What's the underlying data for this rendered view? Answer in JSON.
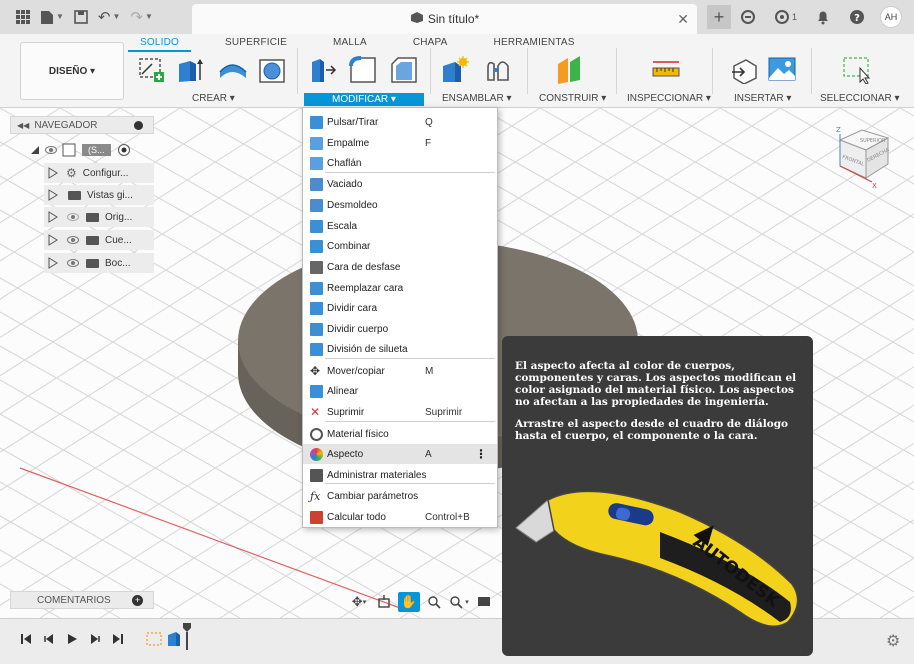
{
  "titlebar": {
    "document_title": "Sin título*",
    "jobs_count": "1",
    "user_initials": "AH"
  },
  "ribbon": {
    "tabs": [
      {
        "label": "SOLIDO",
        "active": true
      },
      {
        "label": "SUPERFICIE",
        "active": false
      },
      {
        "label": "MALLA",
        "active": false
      },
      {
        "label": "CHAPA",
        "active": false
      },
      {
        "label": "HERRAMIENTAS",
        "active": false
      }
    ],
    "workspace": "DISEÑO ▾",
    "groups": {
      "crear": "CREAR ▾",
      "modificar": "MODIFICAR ▾",
      "ensamblar": "ENSAMBLAR ▾",
      "construir": "CONSTRUIR ▾",
      "inspeccionar": "INSPECCIONAR ▾",
      "insertar": "INSERTAR ▾",
      "seleccionar": "SELECCIONAR ▾"
    }
  },
  "navigator": {
    "title": "NAVEGADOR",
    "root_label": "(S...",
    "items": [
      {
        "label": "Configur..."
      },
      {
        "label": "Vistas gi..."
      },
      {
        "label": "Orig..."
      },
      {
        "label": "Cue..."
      },
      {
        "label": "Boc..."
      }
    ]
  },
  "comments": {
    "label": "COMENTARIOS"
  },
  "viewcube": {
    "front": "FRONTAL",
    "right": "DERECHA",
    "top": "SUPERIOR",
    "axis_x": "X",
    "axis_z": "Z"
  },
  "menu": {
    "items": [
      {
        "label": "Pulsar/Tirar",
        "shortcut": "Q",
        "icon_color": "#3a8fd6"
      },
      {
        "label": "Empalme",
        "shortcut": "F",
        "icon_color": "#5aa0e0"
      },
      {
        "label": "Chaflán",
        "shortcut": "",
        "icon_color": "#5aa0e0"
      },
      {
        "label": "Vaciado",
        "shortcut": "",
        "icon_color": "#4b8ccf"
      },
      {
        "label": "Desmoldeo",
        "shortcut": "",
        "icon_color": "#4b8ccf"
      },
      {
        "label": "Escala",
        "shortcut": "",
        "icon_color": "#3a8fd6"
      },
      {
        "label": "Combinar",
        "shortcut": "",
        "icon_color": "#3a8fd6"
      },
      {
        "label": "Cara de desfase",
        "shortcut": "",
        "icon_color": "#666666"
      },
      {
        "label": "Reemplazar cara",
        "shortcut": "",
        "icon_color": "#3a8fd6"
      },
      {
        "label": "Dividir cara",
        "shortcut": "",
        "icon_color": "#3a8fd6"
      },
      {
        "label": "Dividir cuerpo",
        "shortcut": "",
        "icon_color": "#3a8fd6"
      },
      {
        "label": "División de silueta",
        "shortcut": "",
        "icon_color": "#3a8fd6"
      },
      {
        "label": "Mover/copiar",
        "shortcut": "M",
        "icon_color": "#333333"
      },
      {
        "label": "Alinear",
        "shortcut": "",
        "icon_color": "#3a8fd6"
      },
      {
        "label": "Suprimir",
        "shortcut": "Suprimir",
        "icon_color": "#e03030"
      },
      {
        "label": "Material físico",
        "shortcut": "",
        "icon_color": "#555555"
      },
      {
        "label": "Aspecto",
        "shortcut": "A",
        "icon_color": "#e8a030"
      },
      {
        "label": "Administrar materiales",
        "shortcut": "",
        "icon_color": "#555555"
      },
      {
        "label": "Cambiar parámetros",
        "shortcut": "",
        "icon_color": "#333333"
      },
      {
        "label": "Calcular todo",
        "shortcut": "Control+B",
        "icon_color": "#d04030"
      }
    ]
  },
  "tooltip": {
    "paragraph1": "El aspecto afecta al color de cuerpos, componentes y caras. Los aspectos modifican el color asignado del material físico. Los aspectos no afectan a las propiedades de ingeniería.",
    "paragraph2": "Arrastre el aspecto desde el cuadro de diálogo hasta el cuerpo, el componente o la cara.",
    "brand": "AUTODESK"
  },
  "colors": {
    "accent": "#0696d7",
    "tooltip_bg": "#3b3b3b",
    "body_color": "#7a746a",
    "knife_yellow": "#f2d21a"
  }
}
